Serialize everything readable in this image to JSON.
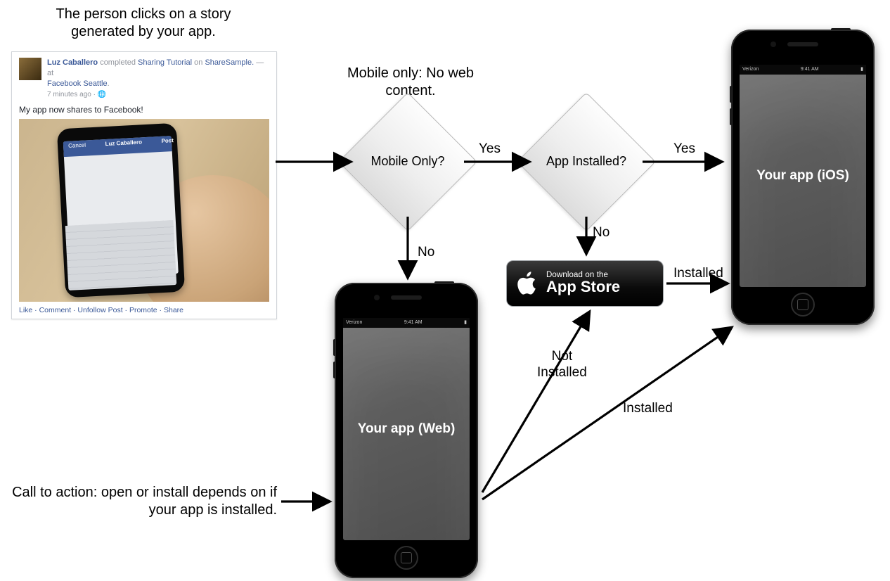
{
  "captions": {
    "top_left": "The person clicks on a story generated by your app.",
    "mobile_only_note": "Mobile only: No web content.",
    "bottom_left": "Call to action: open or install depends on if your app is installed."
  },
  "fb_story": {
    "author_name": "Luz Caballero",
    "action_verb": "completed",
    "object_name": "Sharing Tutorial",
    "action_prep": "on",
    "app_name": "ShareSample.",
    "place_prefix": "— at",
    "place": "Facebook Seattle",
    "timestamp": "7 minutes ago",
    "body": "My app now shares to Facebook!",
    "compose_navbar": {
      "cancel": "Cancel",
      "title": "Luz Caballero",
      "post": "Post"
    },
    "actions": "Like · Comment · Unfollow Post · Promote · Share"
  },
  "decisions": {
    "mobile_only": "Mobile Only?",
    "app_installed": "App Installed?"
  },
  "edges": {
    "yes1": "Yes",
    "yes2": "Yes",
    "no1": "No",
    "no2": "No",
    "installed1": "Installed",
    "installed2": "Installed",
    "not_installed": "Not Installed"
  },
  "phones": {
    "ios_label": "Your app (iOS)",
    "web_label": "Your app (Web)",
    "status_time": "9:41 AM",
    "status_carrier": "Verizon"
  },
  "appstore": {
    "line1": "Download on the",
    "line2": "App Store"
  }
}
